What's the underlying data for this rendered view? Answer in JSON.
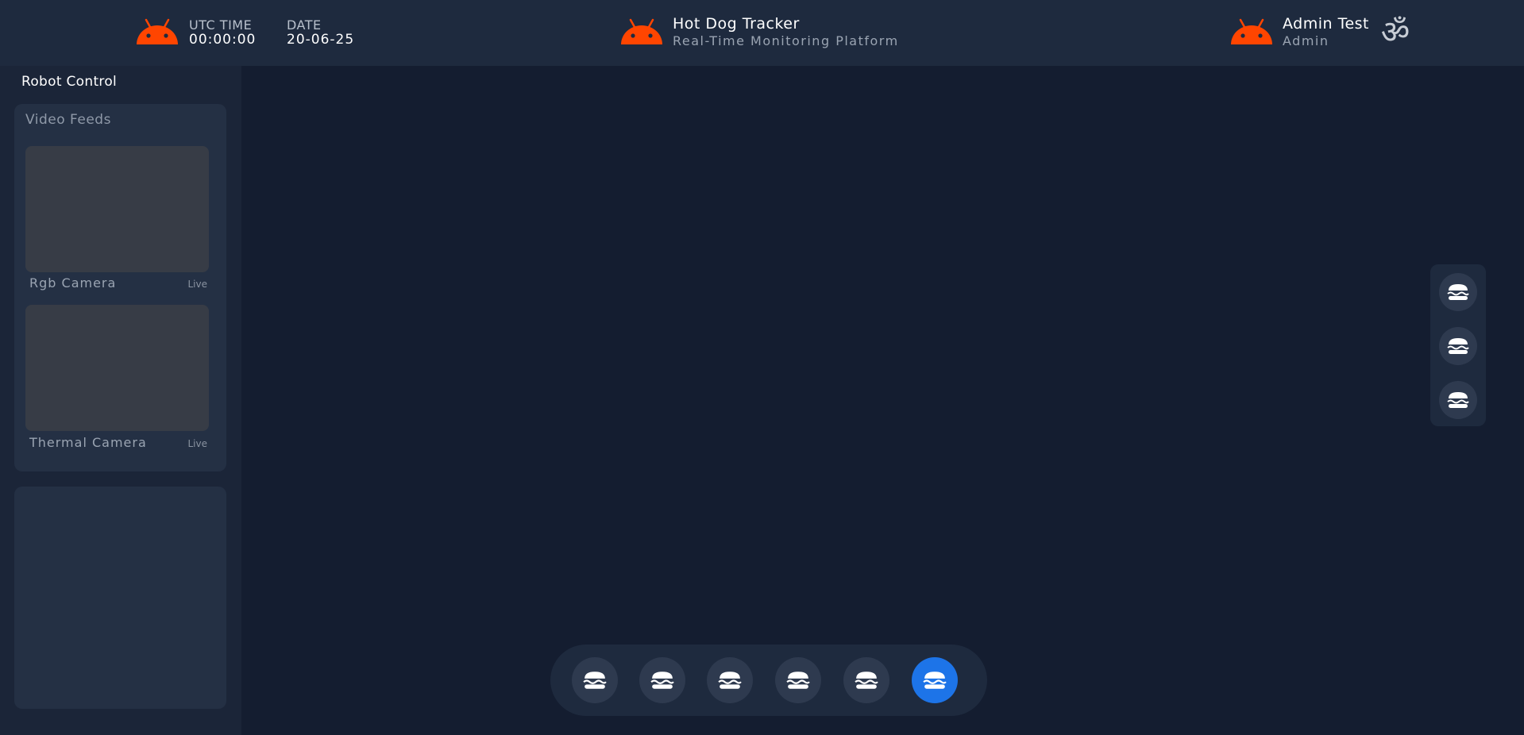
{
  "colors": {
    "accent": "#ff4500",
    "active_button": "#1d74e8",
    "background": "#141d30",
    "topbar": "#1e2a3e"
  },
  "header": {
    "utc_label": "UTC TIME",
    "utc_value": "00:00:00",
    "date_label": "DATE",
    "date_value": "20-06-25",
    "app_title": "Hot Dog Tracker",
    "app_subtitle": "Real-Time Monitoring Platform",
    "user_name": "Admin Test",
    "user_role": "Admin",
    "logo_icon": "android-icon",
    "user_icon": "om-icon",
    "om_glyph": "ॐ"
  },
  "sidebar": {
    "title": "Robot Control",
    "video_feeds_title": "Video Feeds",
    "feeds": [
      {
        "label": "Rgb Camera",
        "status": "Live"
      },
      {
        "label": "Thermal Camera",
        "status": "Live"
      }
    ]
  },
  "bottom_dock": {
    "buttons": [
      {
        "icon": "burger-icon",
        "active": false
      },
      {
        "icon": "burger-icon",
        "active": false
      },
      {
        "icon": "burger-icon",
        "active": false
      },
      {
        "icon": "burger-icon",
        "active": false
      },
      {
        "icon": "burger-icon",
        "active": false
      },
      {
        "icon": "burger-icon",
        "active": true
      }
    ]
  },
  "side_dock": {
    "buttons": [
      {
        "icon": "burger-icon"
      },
      {
        "icon": "burger-icon"
      },
      {
        "icon": "burger-icon"
      }
    ]
  }
}
